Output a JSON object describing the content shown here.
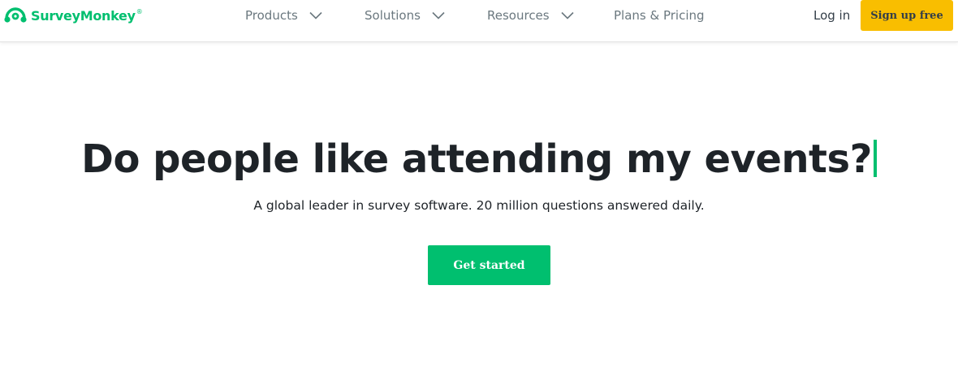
{
  "brand": {
    "name": "SurveyMonkey",
    "trademark": "®",
    "color": "#00bf6f",
    "icon": "surveymonkey-logo-icon"
  },
  "nav": {
    "items": [
      {
        "label": "Products",
        "has_dropdown": true
      },
      {
        "label": "Solutions",
        "has_dropdown": true
      },
      {
        "label": "Resources",
        "has_dropdown": true
      },
      {
        "label": "Plans & Pricing",
        "has_dropdown": false
      }
    ],
    "chevron_icon": "chevron-down-icon"
  },
  "auth": {
    "login_label": "Log in",
    "signup_label": "Sign up free",
    "signup_color": "#f9be00"
  },
  "hero": {
    "title": "Do people like attending my events?",
    "subtitle": "A global leader in survey software. 20 million questions answered daily.",
    "cta_label": "Get started",
    "cta_color": "#00bf6f"
  }
}
